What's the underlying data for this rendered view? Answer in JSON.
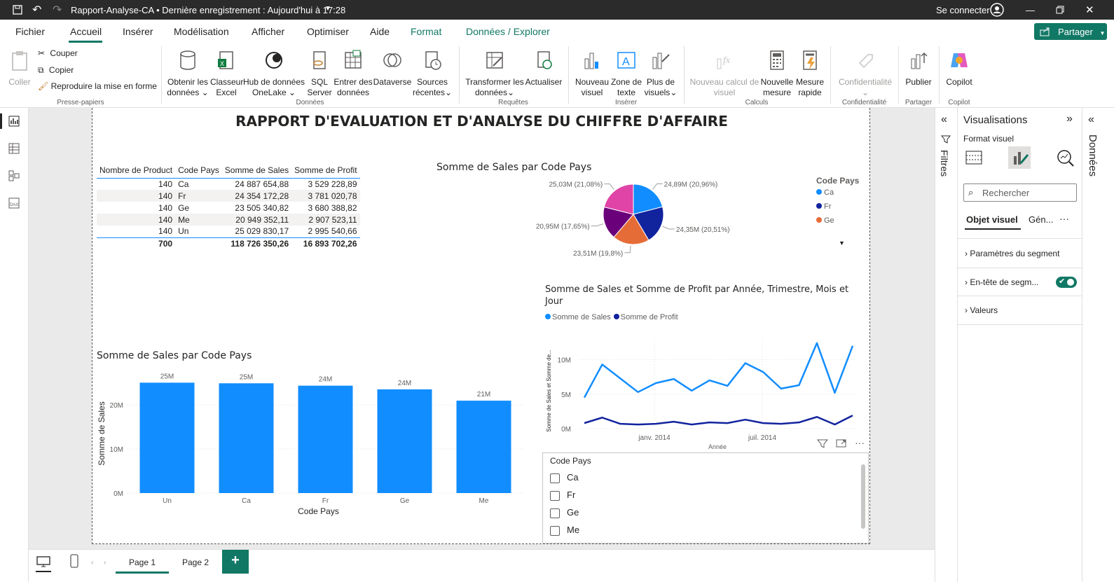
{
  "titlebar": {
    "doc_title": "Rapport-Analyse-CA • Dernière enregistrement : Aujourd'hui à 17:28",
    "signin": "Se connecter"
  },
  "menu": {
    "items": [
      "Fichier",
      "Accueil",
      "Insérer",
      "Modélisation",
      "Afficher",
      "Optimiser",
      "Aide",
      "Format",
      "Données / Explorer"
    ],
    "share": "Partager"
  },
  "ribbon": {
    "paste": "Coller",
    "cut": "Couper",
    "copy": "Copier",
    "format_painter": "Reproduire la mise en forme",
    "clipboard_group": "Presse-papiers",
    "get_data_1": "Obtenir les",
    "get_data_2": "données",
    "excel_1": "Classeur",
    "excel_2": "Excel",
    "onelake_1": "Hub de données",
    "onelake_2": "OneLake",
    "sql_1": "SQL",
    "sql_2": "Server",
    "enter_1": "Entrer des",
    "enter_2": "données",
    "dataverse": "Dataverse",
    "recent_1": "Sources",
    "recent_2": "récentes",
    "data_group": "Données",
    "transform_1": "Transformer les",
    "transform_2": "données",
    "refresh": "Actualiser",
    "queries_group": "Requêtes",
    "newvisual_1": "Nouveau",
    "newvisual_2": "visuel",
    "textbox_1": "Zone de",
    "textbox_2": "texte",
    "morevisuals_1": "Plus de",
    "morevisuals_2": "visuels",
    "insert_group": "Insérer",
    "newcalc_1": "Nouveau calcul de",
    "newcalc_2": "visuel",
    "newmeasure_1": "Nouvelle",
    "newmeasure_2": "mesure",
    "quickmeasure_1": "Mesure",
    "quickmeasure_2": "rapide",
    "calc_group": "Calculs",
    "sensitivity": "Confidentialité",
    "sensitivity_group": "Confidentialité",
    "publish": "Publier",
    "share_group": "Partager",
    "copilot": "Copilot",
    "copilot_group": "Copilot"
  },
  "report": {
    "title": "RAPPORT D'EVALUATION ET D'ANALYSE DU CHIFFRE D'AFFAIRE",
    "table": {
      "headers": [
        "Nombre de Product",
        "Code Pays",
        "Somme de Sales",
        "Somme de Profit"
      ],
      "rows": [
        [
          "140",
          "Ca",
          "24 887 654,88",
          "3 529 228,89"
        ],
        [
          "140",
          "Fr",
          "24 354 172,28",
          "3 781 020,78"
        ],
        [
          "140",
          "Ge",
          "23 505 340,82",
          "3 680 388,82"
        ],
        [
          "140",
          "Me",
          "20 949 352,11",
          "2 907 523,11"
        ],
        [
          "140",
          "Un",
          "25 029 830,17",
          "2 995 540,66"
        ]
      ],
      "total": [
        "700",
        "",
        "118 726 350,26",
        "16 893 702,26"
      ]
    },
    "slicer": {
      "title": "Code Pays",
      "items": [
        "Ca",
        "Fr",
        "Ge",
        "Me"
      ]
    }
  },
  "chart_data": [
    {
      "type": "pie",
      "title": "Somme de Sales par Code Pays",
      "legend_title": "Code Pays",
      "legend": [
        "Ca",
        "Fr",
        "Ge"
      ],
      "slices": [
        {
          "label": "24,89M (20,96%)",
          "value": 24.89,
          "color": "#118DFF"
        },
        {
          "label": "24,35M (20,51%)",
          "value": 24.35,
          "color": "#12239E"
        },
        {
          "label": "23,51M (19,8%)",
          "value": 23.51,
          "color": "#E66C37"
        },
        {
          "label": "20,95M (17,65%)",
          "value": 20.95,
          "color": "#6B007B"
        },
        {
          "label": "25,03M (21,08%)",
          "value": 25.03,
          "color": "#E044A7"
        }
      ]
    },
    {
      "type": "bar",
      "title": "Somme de Sales par Code Pays",
      "xlabel": "Code Pays",
      "ylabel": "Somme de Sales",
      "categories": [
        "Un",
        "Ca",
        "Fr",
        "Ge",
        "Me"
      ],
      "values": [
        25.03,
        24.89,
        24.35,
        23.51,
        20.95
      ],
      "data_labels": [
        "25M",
        "25M",
        "24M",
        "24M",
        "21M"
      ],
      "yticks": [
        "0M",
        "10M",
        "20M"
      ],
      "ylim": [
        0,
        27
      ],
      "color": "#118DFF"
    },
    {
      "type": "line",
      "title": "Somme de Sales et Somme de Profit par Année, Trimestre, Mois et Jour",
      "xlabel": "Année",
      "ylabel": "Somme de Sales et Somme de...",
      "xticks": [
        "janv. 2014",
        "juil. 2014"
      ],
      "yticks": [
        "0M",
        "5M",
        "10M"
      ],
      "ylim": [
        0,
        13
      ],
      "series": [
        {
          "name": "Somme de  Sales",
          "color": "#118DFF",
          "values": [
            4.5,
            9.3,
            7.3,
            5.3,
            6.6,
            7.2,
            5.5,
            7.0,
            6.2,
            9.5,
            8.2,
            5.8,
            6.3,
            12.4,
            5.2,
            12.0
          ]
        },
        {
          "name": "Somme de Profit",
          "color": "#12239E",
          "values": [
            0.8,
            1.6,
            0.7,
            0.6,
            0.7,
            1.0,
            0.6,
            0.9,
            0.8,
            1.3,
            0.8,
            0.7,
            0.9,
            1.7,
            0.6,
            1.9
          ]
        }
      ]
    }
  ],
  "bottom": {
    "tabs": [
      "Page 1",
      "Page 2"
    ],
    "add": "+"
  },
  "panes": {
    "filters": "Filtres",
    "viz_title": "Visualisations",
    "format_visual": "Format visuel",
    "search_placeholder": "Rechercher",
    "tab_visual": "Objet visuel",
    "tab_general": "Gén...",
    "more": "···",
    "sections": [
      "Paramètres du segment",
      "En-tête de segm...",
      "Valeurs"
    ],
    "data": "Données"
  }
}
